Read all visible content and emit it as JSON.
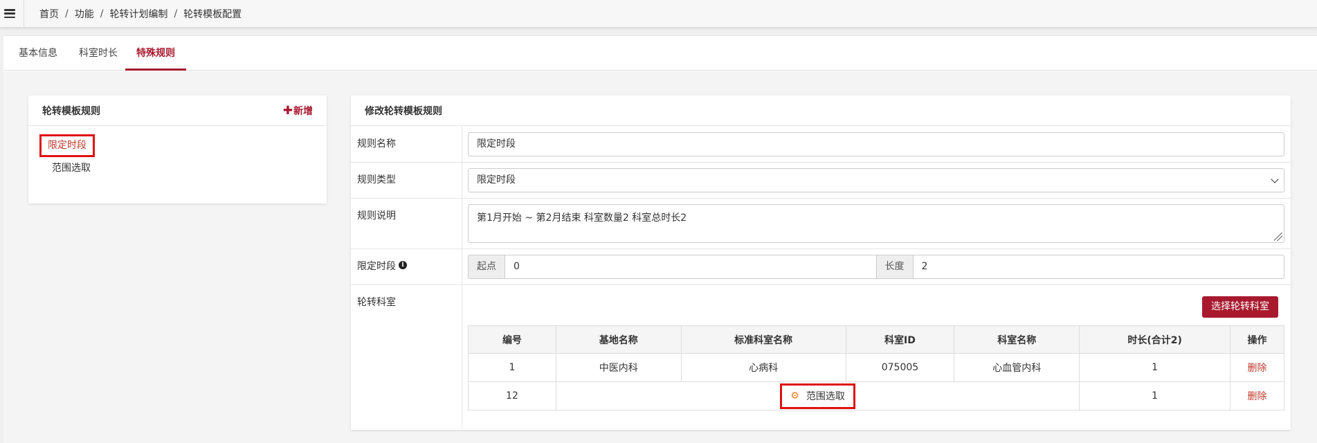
{
  "breadcrumb": [
    "首页",
    "功能",
    "轮转计划编制",
    "轮转模板配置"
  ],
  "breadcrumb_sep": "/",
  "tabs": [
    {
      "label": "基本信息",
      "active": false
    },
    {
      "label": "科室时长",
      "active": false
    },
    {
      "label": "特殊规则",
      "active": true
    }
  ],
  "left_card": {
    "title": "轮转模板规则",
    "add_label": "新增",
    "add_plus": "✚",
    "rules": [
      "限定时段",
      "范围选取"
    ]
  },
  "right_card": {
    "title": "修改轮转模板规则",
    "fields": {
      "name_label": "规则名称",
      "name_value": "限定时段",
      "type_label": "规则类型",
      "type_value": "限定时段",
      "desc_label": "规则说明",
      "desc_value": "第1月开始 ~ 第2月结束 科室数量2 科室总时长2",
      "period_label": "限定时段",
      "start_label": "起点",
      "start_value": "0",
      "length_label": "长度",
      "length_value": "2",
      "dept_label": "轮转科室"
    },
    "select_dept_label": "选择轮转科室",
    "table": {
      "headers": [
        "编号",
        "基地名称",
        "标准科室名称",
        "科室ID",
        "科室名称",
        "时长(合计2)",
        "操作"
      ],
      "rows": [
        {
          "no": "1",
          "base": "中医内科",
          "std_dept": "心病科",
          "dept_id": "075005",
          "dept_name": "心血管内科",
          "duration": "1",
          "action": "删除"
        },
        {
          "no": "12",
          "range_label": "范围选取",
          "duration": "1",
          "action": "删除"
        }
      ]
    }
  },
  "colors": {
    "accent": "#a8192e",
    "highlight_border": "#e01010",
    "gear": "#e67e22"
  },
  "icons": {
    "menu": "hamburger-menu-icon",
    "add": "plus-icon",
    "info": "info-circle-icon",
    "gear": "gears-icon",
    "select": "chevron-down-icon"
  }
}
